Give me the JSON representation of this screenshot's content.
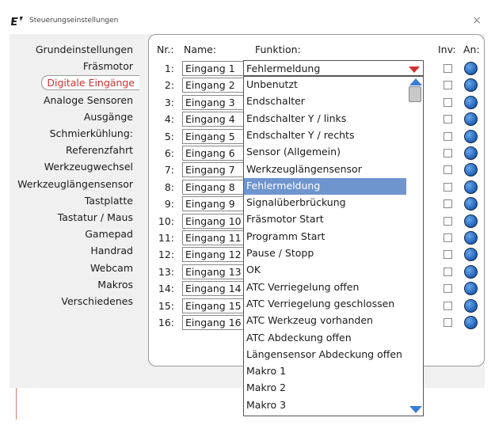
{
  "window": {
    "title": "Steuerungseinstellungen",
    "close_glyph": "×",
    "icon": "app-logo-icon"
  },
  "sidebar": {
    "items": [
      {
        "label": "Grundeinstellungen",
        "active": false
      },
      {
        "label": "Fräsmotor",
        "active": false
      },
      {
        "label": "Digitale Eingänge",
        "active": true
      },
      {
        "label": "Analoge Sensoren",
        "active": false
      },
      {
        "label": "Ausgänge",
        "active": false
      },
      {
        "label": "Schmierkühlung:",
        "active": false
      },
      {
        "label": "Referenzfahrt",
        "active": false
      },
      {
        "label": "Werkzeugwechsel",
        "active": false
      },
      {
        "label": "Werkzeuglängensensor",
        "active": false
      },
      {
        "label": "Tastplatte",
        "active": false
      },
      {
        "label": "Tastatur / Maus",
        "active": false
      },
      {
        "label": "Gamepad",
        "active": false
      },
      {
        "label": "Handrad",
        "active": false
      },
      {
        "label": "Webcam",
        "active": false
      },
      {
        "label": "Makros",
        "active": false
      },
      {
        "label": "Verschiedenes",
        "active": false
      }
    ]
  },
  "table": {
    "headers": {
      "nr": "Nr.:",
      "name": "Name:",
      "function": "Funktion:",
      "inv": "Inv:",
      "on": "An:"
    },
    "rows": [
      {
        "nr": "1:",
        "name": "Eingang 1"
      },
      {
        "nr": "2:",
        "name": "Eingang 2"
      },
      {
        "nr": "3:",
        "name": "Eingang 3"
      },
      {
        "nr": "4:",
        "name": "Eingang 4"
      },
      {
        "nr": "5:",
        "name": "Eingang 5"
      },
      {
        "nr": "6:",
        "name": "Eingang 6"
      },
      {
        "nr": "7:",
        "name": "Eingang 7"
      },
      {
        "nr": "8:",
        "name": "Eingang 8"
      },
      {
        "nr": "9:",
        "name": "Eingang 9"
      },
      {
        "nr": "10:",
        "name": "Eingang 10"
      },
      {
        "nr": "11:",
        "name": "Eingang 11"
      },
      {
        "nr": "12:",
        "name": "Eingang 12"
      },
      {
        "nr": "13:",
        "name": "Eingang 13"
      },
      {
        "nr": "14:",
        "name": "Eingang 14"
      },
      {
        "nr": "15:",
        "name": "Eingang 15"
      },
      {
        "nr": "16:",
        "name": "Eingang 16"
      }
    ]
  },
  "function_select": {
    "value": "Fehlermeldung",
    "selected_index": 6,
    "options": [
      "Unbenutzt",
      "Endschalter",
      "Endschalter Y / links",
      "Endschalter Y / rechts",
      "Sensor (Allgemein)",
      "Werkzeuglängensensor",
      "Fehlermeldung",
      "Signalüberbrückung",
      "Fräsmotor Start",
      "Programm Start",
      "Pause / Stopp",
      "OK",
      "ATC Verriegelung offen",
      "ATC Verriegelung geschlossen",
      "ATC Werkzeug vorhanden",
      "ATC Abdeckung offen",
      "Längensensor Abdeckung offen",
      "Makro 1",
      "Makro 2",
      "Makro 3"
    ]
  },
  "colors": {
    "accent_red": "#d03030",
    "highlight_blue": "#6f95cf",
    "led_blue": "#2d6ec4"
  }
}
